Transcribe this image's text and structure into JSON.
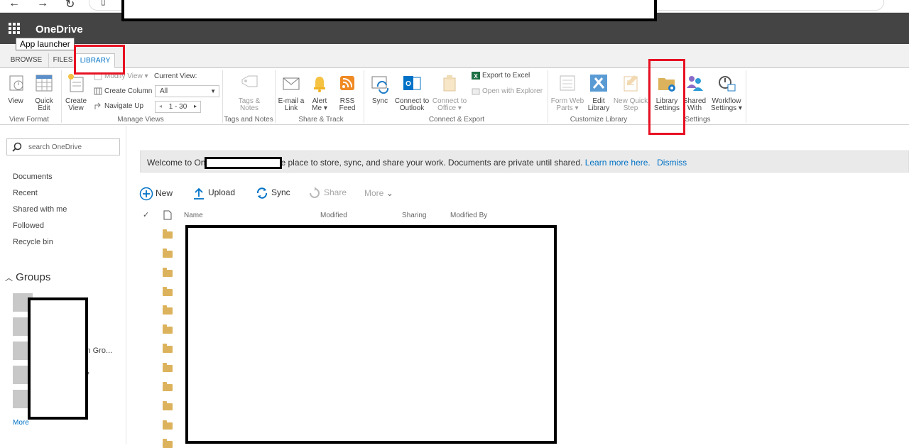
{
  "browser": {
    "back_glyph": "←",
    "forward_glyph": "→",
    "reload_glyph": "↻",
    "page_glyph": "▯"
  },
  "suite_bar": {
    "brand": "OneDrive",
    "waffle_icon": "waffle-icon",
    "tooltip": "App launcher"
  },
  "ribbon_tabs": [
    "BROWSE",
    "FILES",
    "LIBRARY"
  ],
  "ribbon": {
    "view_format": {
      "view": "View",
      "quick_edit": [
        "Quick",
        "Edit"
      ],
      "label": "View Format"
    },
    "manage_views": {
      "create_view": [
        "Create",
        "View"
      ],
      "modify_view": "Modify View",
      "create_column": "Create Column",
      "navigate_up": "Navigate Up",
      "current_view_label": "Current View:",
      "current_view_value": "All",
      "pager": "1 - 30",
      "label": "Manage Views"
    },
    "tags_notes": {
      "button": [
        "Tags &",
        "Notes"
      ],
      "label": "Tags and Notes"
    },
    "share_track": {
      "email": [
        "E-mail a",
        "Link"
      ],
      "alert": [
        "Alert",
        "Me"
      ],
      "rss": [
        "RSS",
        "Feed"
      ],
      "label": "Share & Track"
    },
    "connect_export": {
      "sync": "Sync",
      "outlook": [
        "Connect to",
        "Outlook"
      ],
      "office": [
        "Connect to",
        "Office"
      ],
      "export_excel": "Export to Excel",
      "open_explorer": "Open with Explorer",
      "label": "Connect & Export"
    },
    "customize": {
      "form_web_parts": [
        "Form Web",
        "Parts"
      ],
      "edit_library": [
        "Edit",
        "Library"
      ],
      "new_quick_step": [
        "New Quick",
        "Step"
      ],
      "label": "Customize Library"
    },
    "settings": {
      "library_settings": [
        "Library",
        "Settings"
      ],
      "shared_with": [
        "Shared",
        "With"
      ],
      "workflow_settings": [
        "Workflow",
        "Settings"
      ],
      "label": "Settings"
    }
  },
  "left_nav": {
    "search_placeholder": "search OneDrive",
    "links": [
      "Documents",
      "Recent",
      "Shared with me",
      "Followed",
      "Recycle bin"
    ],
    "groups_heading": "Groups",
    "group_fragments": [
      "ch Gro...",
      "v"
    ],
    "more": "More"
  },
  "welcome": {
    "prefix": "Welcome to On",
    "suffix": "e place to store, sync, and share your work. Documents are private until shared.",
    "learn_more": "Learn more here.",
    "dismiss": "Dismiss"
  },
  "commands": {
    "new": "New",
    "upload": "Upload",
    "sync": "Sync",
    "share": "Share",
    "more": "More"
  },
  "columns": {
    "name": "Name",
    "modified": "Modified",
    "sharing": "Sharing",
    "modified_by": "Modified By"
  },
  "colors": {
    "suite_bar": "#444444",
    "accent": "#0072c6",
    "highlight": "#e81123",
    "folder": "#dcb35c"
  }
}
